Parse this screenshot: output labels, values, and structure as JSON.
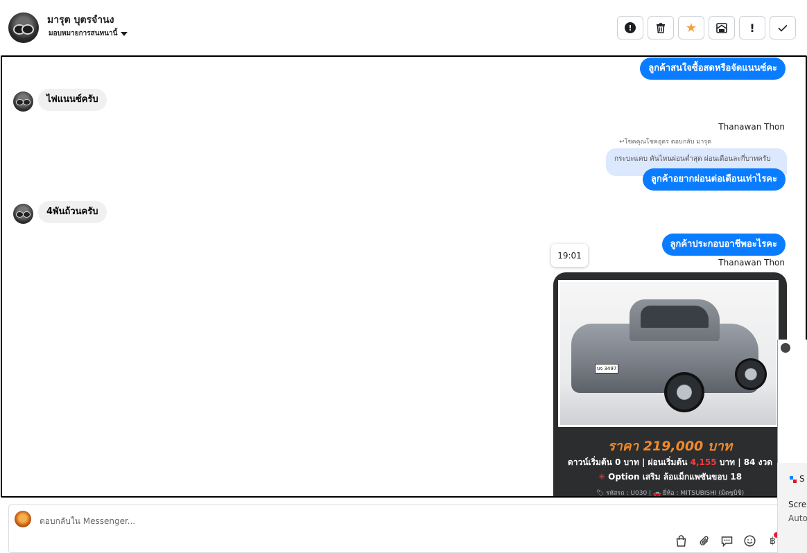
{
  "header": {
    "contact_name": "มารุต บุตรจำนง",
    "assign_label": "มอบหมายการสนทนานี้",
    "toolbar_icons": [
      "alert-circle-icon",
      "trash-icon",
      "star-icon",
      "mark-unread-icon",
      "exclamation-icon",
      "check-icon"
    ]
  },
  "messages": {
    "m1": "ลูกค้าสนใจซื้อสดหรือจัดแนนซ์คะ",
    "m2": "ไฟแนนซ์ครับ",
    "sender_1": "Thanawan Thon",
    "reply_hint": "↩โชคคุณโชคอุดร ตอบกลับ มารุต",
    "quoted": "กระบะแคบ คันไหนผ่อนต่ำสุด ผ่อนเดือนละกี่บาทครับ",
    "m3": "ลูกค้าอยากผ่อนต่อเดือนเท่าไรคะ",
    "m4": "4พันถ้วนครับ",
    "m5": "ลูกค้าประกอบอาชีพอะไรคะ",
    "timestamp": "19:01",
    "sender_2": "Thanawan Thon"
  },
  "card": {
    "plate": "บจ 3497",
    "price": "ราคา 219,000 บาท",
    "terms_a": "ดาวน์เริ่มต้น 0 บาท | ผ่อนเริ่มต้น ",
    "terms_amount": "4,155",
    "terms_b": " บาท | 84 งวด",
    "option_mark": "✳",
    "option": " Option เสริม ล้อแม็กแพซันขอบ 18",
    "code": "🏷 รหัสรถ : U030 | 🚗 ยี่ห้อ : MITSUBISHI (มิตซูบิชิ)"
  },
  "composer": {
    "placeholder": "ตอบกลับใน Messenger...",
    "icons": [
      "shopping-bag-icon",
      "paperclip-icon",
      "chat-bubble-icon",
      "emoji-icon",
      "baht-icon"
    ]
  },
  "edge_toast": {
    "t1": "S",
    "t2": "Scre",
    "t3": "Auto"
  },
  "colors": {
    "accent": "#0a7cff",
    "incoming_bubble": "#f0f0f0",
    "price": "#f08a2b",
    "highlight_red": "#ff3a3a"
  }
}
